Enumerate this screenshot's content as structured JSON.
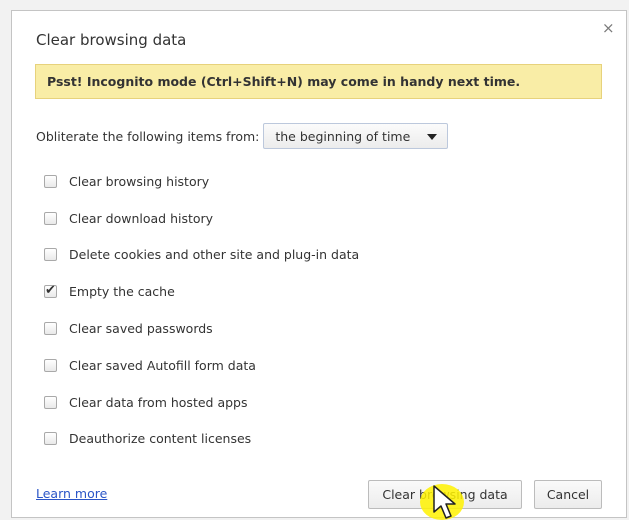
{
  "dialog": {
    "title": "Clear browsing data",
    "close_label": "×"
  },
  "banner": {
    "text": "Psst! Incognito mode (Ctrl+Shift+N) may come in handy next time."
  },
  "obliterate": {
    "label": "Obliterate the following items from:",
    "selected": "the beginning of time"
  },
  "items": [
    {
      "label": "Clear browsing history",
      "checked": false
    },
    {
      "label": "Clear download history",
      "checked": false
    },
    {
      "label": "Delete cookies and other site and plug-in data",
      "checked": false
    },
    {
      "label": "Empty the cache",
      "checked": true
    },
    {
      "label": "Clear saved passwords",
      "checked": false
    },
    {
      "label": "Clear saved Autofill form data",
      "checked": false
    },
    {
      "label": "Clear data from hosted apps",
      "checked": false
    },
    {
      "label": "Deauthorize content licenses",
      "checked": false
    }
  ],
  "footer": {
    "learn_more": "Learn more",
    "clear_button": "Clear browsing data",
    "cancel_button": "Cancel"
  },
  "colors": {
    "banner_bg": "#f9eda6",
    "link": "#2a55c7",
    "cursor_highlight": "#fff200"
  },
  "icons": {
    "close": "close-icon",
    "dropdown": "chevron-down-icon",
    "check": "checkmark-icon",
    "cursor": "mouse-pointer-icon"
  }
}
